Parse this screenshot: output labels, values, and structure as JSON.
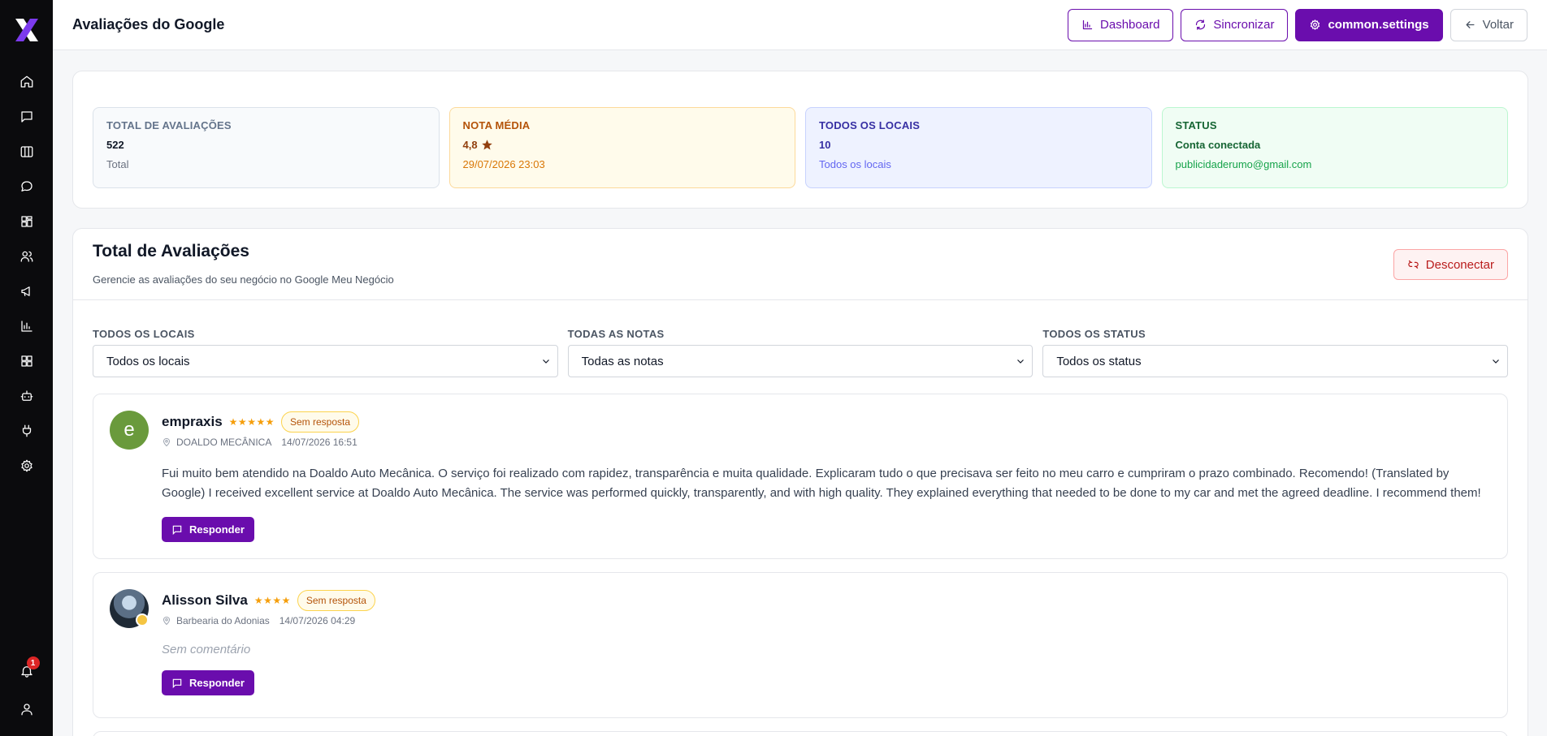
{
  "header": {
    "title": "Avaliações do Google",
    "dashboard_label": "Dashboard",
    "sync_label": "Sincronizar",
    "settings_label": "common.settings",
    "back_label": "Voltar"
  },
  "sidebar": {
    "items": [
      {
        "icon": "home-icon"
      },
      {
        "icon": "message-square-icon"
      },
      {
        "icon": "columns-icon"
      },
      {
        "icon": "chat-bubble-icon"
      },
      {
        "icon": "grid-icon"
      },
      {
        "icon": "users-icon"
      },
      {
        "icon": "megaphone-icon"
      },
      {
        "icon": "bar-chart-icon"
      },
      {
        "icon": "apps-icon"
      },
      {
        "icon": "bot-icon"
      },
      {
        "icon": "plug-icon"
      },
      {
        "icon": "gear-icon"
      }
    ],
    "notification_count": "1"
  },
  "stats": {
    "total": {
      "label": "TOTAL DE AVALIAÇÕES",
      "value": "522",
      "sub": "Total"
    },
    "rating": {
      "label": "NOTA MÉDIA",
      "value": "4,8",
      "sub": "29/07/2026 23:03"
    },
    "locations": {
      "label": "TODOS OS LOCAIS",
      "value": "10",
      "sub": "Todos os locais"
    },
    "status": {
      "label": "STATUS",
      "value": "Conta conectada",
      "sub": "publicidaderumo@gmail.com"
    }
  },
  "reviews_panel": {
    "title": "Total de Avaliações",
    "subtitle": "Gerencie as avaliações do seu negócio no Google Meu Negócio",
    "disconnect_label": "Desconectar"
  },
  "filters": {
    "locations": {
      "label": "TODOS OS LOCAIS",
      "selected": "Todos os locais"
    },
    "ratings": {
      "label": "TODAS AS NOTAS",
      "selected": "Todas as notas"
    },
    "status": {
      "label": "TODOS OS STATUS",
      "selected": "Todos os status"
    }
  },
  "reviews": [
    {
      "avatar_letter": "e",
      "name": "empraxis",
      "stars": "★★★★★",
      "rating": 5,
      "status": "Sem resposta",
      "location": "DOALDO MECÂNICA",
      "date": "14/07/2026 16:51",
      "text": "Fui muito bem atendido na Doaldo Auto Mecânica. O serviço foi realizado com rapidez, transparência e muita qualidade. Explicaram tudo o que precisava ser feito no meu carro e cumpriram o prazo combinado. Recomendo! (Translated by Google) I received excellent service at Doaldo Auto Mecânica. The service was performed quickly, transparently, and with high quality. They explained everything that needed to be done to my car and met the agreed deadline. I recommend them!",
      "reply_label": "Responder"
    },
    {
      "avatar_letter": "",
      "name": "Alisson Silva",
      "stars": "★★★★",
      "rating": 4,
      "status": "Sem resposta",
      "location": "Barbearia do Adonias",
      "date": "14/07/2026 04:29",
      "text": "Sem comentário",
      "reply_label": "Responder"
    }
  ],
  "colors": {
    "brand": "#6a0dad",
    "sidebar": "#0b0b0d",
    "star": "#f59e0b"
  }
}
